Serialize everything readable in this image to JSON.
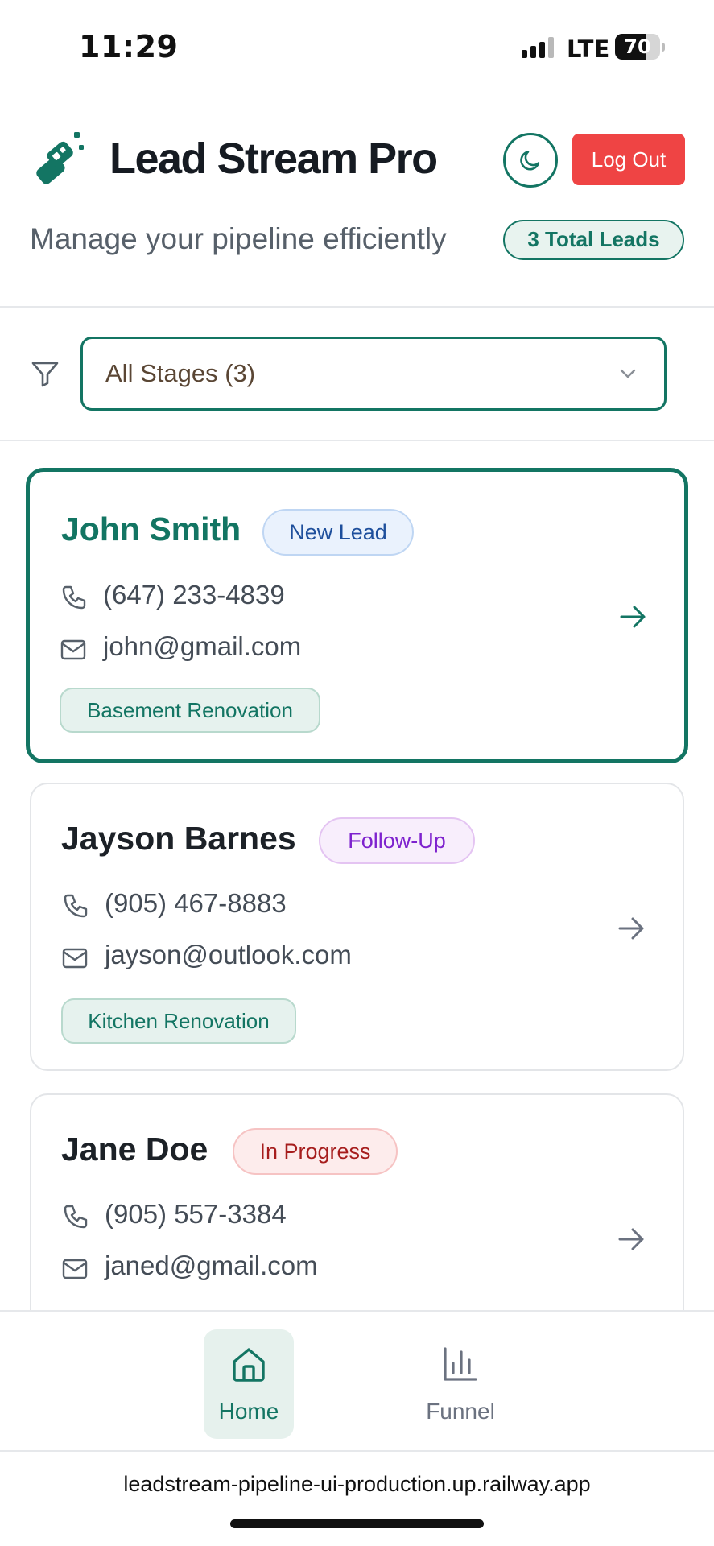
{
  "status_bar": {
    "time": "11:29",
    "network": "LTE",
    "battery": "70",
    "battery_level": 0.7
  },
  "header": {
    "title": "Lead Stream Pro",
    "subtitle": "Manage your pipeline efficiently",
    "total_leads": "3 Total Leads",
    "logout_label": "Log Out",
    "theme_toggle_icon": "moon-icon",
    "logo_icon": "lead-stream-logo-icon"
  },
  "filter": {
    "icon": "filter-icon",
    "selected": "All Stages (3)"
  },
  "leads": [
    {
      "name": "John Smith",
      "stage": "New Lead",
      "stage_color": "#1e4f9c",
      "phone": "(647) 233-4839",
      "email": "john@gmail.com",
      "project": "Basement Renovation",
      "selected": true
    },
    {
      "name": "Jayson Barnes",
      "stage": "Follow-Up",
      "stage_color": "#7e22ce",
      "phone": "(905) 467-8883",
      "email": "jayson@outlook.com",
      "project": "Kitchen Renovation",
      "selected": false
    },
    {
      "name": "Jane Doe",
      "stage": "In Progress",
      "stage_color": "#a61d1d",
      "phone": "(905) 557-3384",
      "email": "janed@gmail.com",
      "project": "",
      "selected": false
    }
  ],
  "nav": {
    "home": "Home",
    "funnel": "Funnel",
    "active": "home"
  },
  "browser": {
    "url": "leadstream-pipeline-ui-production.up.railway.app"
  },
  "colors": {
    "brand": "#137563",
    "danger": "#ef4444"
  }
}
